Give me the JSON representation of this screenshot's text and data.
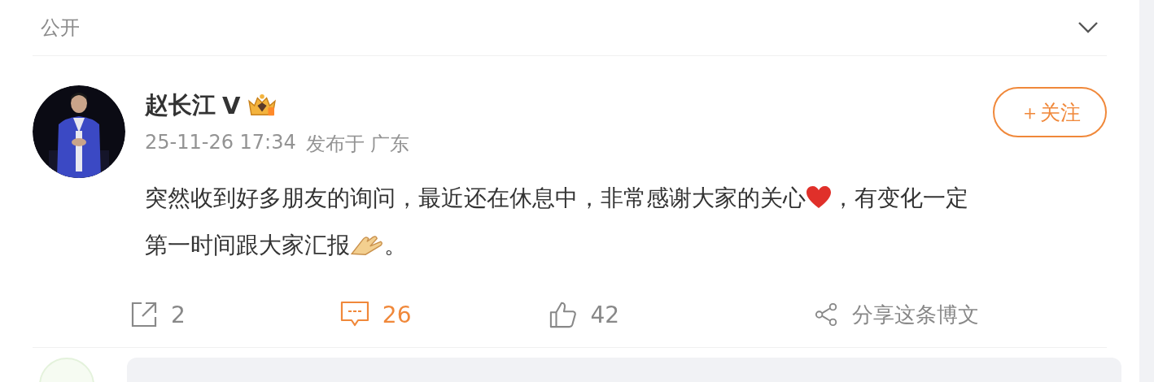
{
  "header": {
    "visibility": "公开"
  },
  "post": {
    "author": "赵长江",
    "verified_mark": "V",
    "time": "25-11-26 17:34",
    "location_prefix": "发布于",
    "location": "广东",
    "follow_label": "＋关注",
    "content": [
      {
        "kind": "text",
        "text": "突然收到好多朋友的询问，最近还在休息中，非常感谢大家的关心"
      },
      {
        "kind": "heart"
      },
      {
        "kind": "text",
        "text": "，有变化一定第一时间跟大家汇报"
      },
      {
        "kind": "hands"
      },
      {
        "kind": "text",
        "text": "。"
      }
    ]
  },
  "actions": [
    {
      "kind": "repost",
      "label": "2",
      "selected": false
    },
    {
      "kind": "comment",
      "label": "26",
      "selected": true
    },
    {
      "kind": "like",
      "label": "42",
      "selected": false
    },
    {
      "kind": "share",
      "label": "分享这条博文",
      "selected": false
    }
  ]
}
